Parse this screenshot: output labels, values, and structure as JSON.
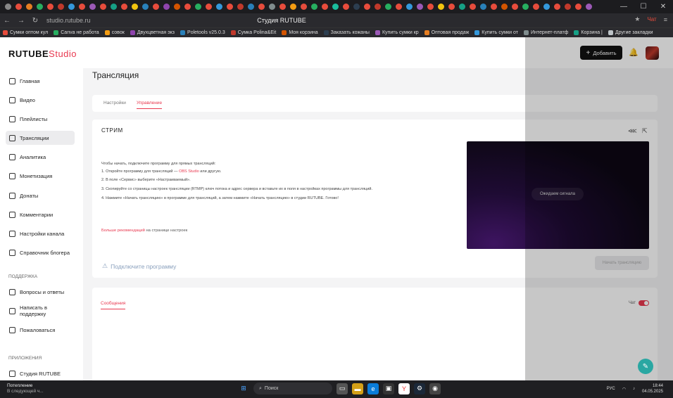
{
  "browser": {
    "page_title": "Студия RUTUBE",
    "url": "studio.rutube.ru",
    "chat_label": "Чат",
    "bookmarks": [
      {
        "label": "Сумки оптом кул",
        "color": "#e74c3c"
      },
      {
        "label": "Canva не работа",
        "color": "#27ae60"
      },
      {
        "label": "совок",
        "color": "#f39c12"
      },
      {
        "label": "Двухцветная экз",
        "color": "#8e44ad"
      },
      {
        "label": "Poletools v25.0.3",
        "color": "#2980b9"
      },
      {
        "label": "Сумка Polina&Eit",
        "color": "#c0392b"
      },
      {
        "label": "Моя корзина",
        "color": "#d35400"
      },
      {
        "label": "Заказать кожаны",
        "color": "#2c3e50"
      },
      {
        "label": "Купить сумки кр",
        "color": "#9b59b6"
      },
      {
        "label": "Оптовая продаж",
        "color": "#e67e22"
      },
      {
        "label": "Купить сумки от",
        "color": "#3498db"
      },
      {
        "label": "Интернет-платф",
        "color": "#7f8c8d"
      },
      {
        "label": "Корзина |",
        "color": "#16a085"
      },
      {
        "label": "Другие закладки",
        "color": "#bdc3c7"
      }
    ]
  },
  "header": {
    "logo_text": "RUTUBE",
    "logo_suffix": "Studio",
    "add_button": "Добавить"
  },
  "sidebar": {
    "items": [
      {
        "label": "Главная",
        "icon": "home-icon"
      },
      {
        "label": "Видео",
        "icon": "video-icon"
      },
      {
        "label": "Плейлисты",
        "icon": "playlist-icon"
      },
      {
        "label": "Трансляции",
        "icon": "broadcast-icon"
      },
      {
        "label": "Аналитика",
        "icon": "analytics-icon"
      },
      {
        "label": "Монетизация",
        "icon": "monetization-icon"
      },
      {
        "label": "Донаты",
        "icon": "donations-icon"
      },
      {
        "label": "Комментарии",
        "icon": "comments-icon"
      },
      {
        "label": "Настройки канала",
        "icon": "settings-icon"
      },
      {
        "label": "Справочник блогера",
        "icon": "guide-icon"
      }
    ],
    "support_section": "Поддержка",
    "support_items": [
      {
        "label": "Вопросы и ответы"
      },
      {
        "label": "Написать в поддержку"
      },
      {
        "label": "Пожаловаться"
      }
    ],
    "apps_section": "Приложения",
    "apps_items": [
      {
        "label": "Студия RUTUBE"
      }
    ]
  },
  "main": {
    "title": "Трансляция",
    "tabs": [
      "Настройки",
      "Управление"
    ],
    "stream": {
      "title": "СТРИМ",
      "instructions": {
        "intro": "Чтобы начать, подключите программу для прямых трансляций:",
        "step1_a": "1. Откройте программу для трансляций — ",
        "step1_link": "OBS Studio",
        "step1_b": " или другую.",
        "step2": "2. В поле «Сервис» выберите «Настраиваемый».",
        "step3": "3. Скопируйте со страницы настроек трансляции (RTMP) ключ потока и адрес сервера и вставьте их в поля в настройках программы для трансляций.",
        "step4": "4. Нажмите «Начать трансляцию» в программе для трансляций, а затем нажмите «Начать трансляцию» в студии RUTUBE. Готово!"
      },
      "more_link": "Больше рекомендаций",
      "more_suffix": " на странице настроек",
      "connect_label": "Подключите программу",
      "waiting_label": "Ожидаем сигнала",
      "start_button": "Начать трансляцию"
    },
    "messages_tab": "Сообщения",
    "chat_toggle_label": "Чат",
    "chat_enabled": true
  },
  "taskbar": {
    "weather_line1": "Потепление",
    "weather_line2": "В следующей ч...",
    "search_placeholder": "Поиск",
    "lang": "РУС",
    "time": "18:44",
    "date": "04.05.2025"
  },
  "colors": {
    "accent": "#e8384f",
    "help_button": "#2aa7a2"
  }
}
